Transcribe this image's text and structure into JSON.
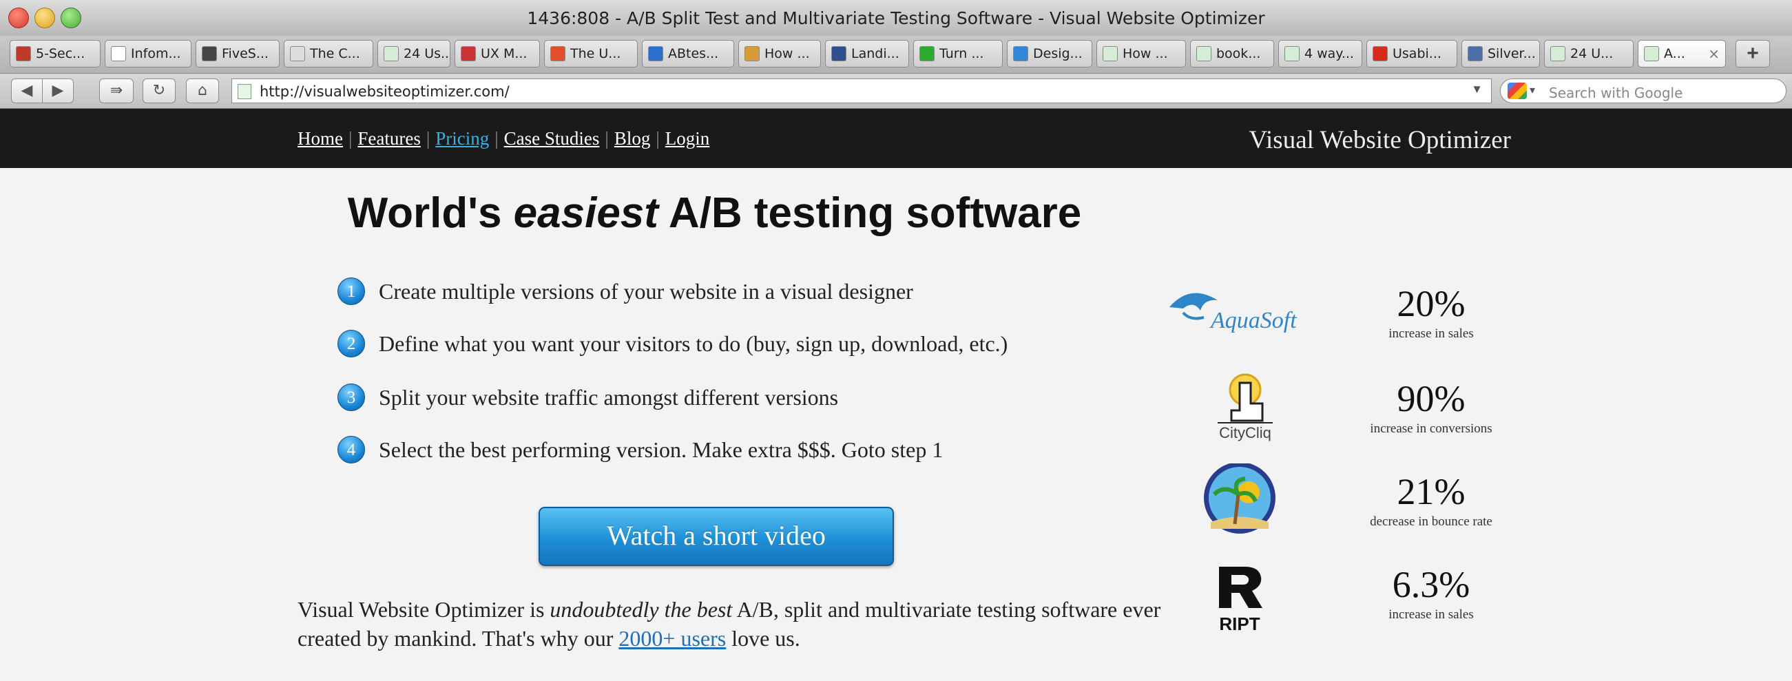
{
  "window": {
    "title": "1436:808 - A/B Split Test and Multivariate Testing Software - Visual Website Optimizer"
  },
  "tabs": [
    {
      "label": "5-Sec...",
      "icon": "five-sec-favicon",
      "color": "#c0392b"
    },
    {
      "label": "Infom...",
      "icon": "blank-favicon",
      "color": "#ffffff"
    },
    {
      "label": "FiveS...",
      "icon": "fivesecond-favicon",
      "color": "#444444"
    },
    {
      "label": "The C...",
      "icon": "page-favicon",
      "color": "#dddddd"
    },
    {
      "label": "24 Us...",
      "icon": "page-favicon",
      "color": "#d5ecd5"
    },
    {
      "label": "UX M...",
      "icon": "uxm-favicon",
      "color": "#cc3333"
    },
    {
      "label": "The U...",
      "icon": "uxbooth-favicon",
      "color": "#e24e2a"
    },
    {
      "label": "ABtes...",
      "icon": "abtests-favicon",
      "color": "#2a6fcf"
    },
    {
      "label": "How ...",
      "icon": "how-favicon",
      "color": "#d99a3a"
    },
    {
      "label": "Landi...",
      "icon": "landing-favicon",
      "color": "#2f4f8f"
    },
    {
      "label": "Turn ...",
      "icon": "turn-favicon",
      "color": "#2eaa2e"
    },
    {
      "label": "Desig...",
      "icon": "design-favicon",
      "color": "#2f87d8"
    },
    {
      "label": "How ...",
      "icon": "page-favicon",
      "color": "#d5ecd5"
    },
    {
      "label": "book...",
      "icon": "page-favicon",
      "color": "#d5ecd5"
    },
    {
      "label": "4 way...",
      "icon": "page-favicon",
      "color": "#d5ecd5"
    },
    {
      "label": "Usabi...",
      "icon": "usability-favicon",
      "color": "#d92a1e"
    },
    {
      "label": "Silver...",
      "icon": "silverback-favicon",
      "color": "#4a6ea8"
    },
    {
      "label": "24 U...",
      "icon": "page-favicon",
      "color": "#d5ecd5"
    },
    {
      "label": "A...",
      "icon": "page-favicon",
      "color": "#d5ecd5",
      "active": true
    }
  ],
  "toolbar": {
    "url": "http://visualwebsiteoptimizer.com/",
    "search_placeholder": "Search with Google",
    "back_icon": "back-arrow-icon",
    "forward_icon": "forward-arrow-icon",
    "reload_icon": "reload-icon",
    "home_icon": "home-icon"
  },
  "site": {
    "nav": [
      "Home",
      "Features",
      "Pricing",
      "Case Studies",
      "Blog",
      "Login"
    ],
    "brand": "Visual Website Optimizer",
    "headline": {
      "pre": "World's ",
      "em": "easiest",
      "post": " A/B testing software"
    },
    "steps": [
      {
        "num": "1",
        "text": "Create multiple versions of your website in a visual designer"
      },
      {
        "num": "2",
        "text": "Define what you want your visitors to do (buy, sign up, download, etc.)"
      },
      {
        "num": "3",
        "text": "Split your website traffic amongst different versions"
      },
      {
        "num": "4",
        "text": "Select the best performing version. Make extra $$$. Goto step 1"
      }
    ],
    "video_button": "Watch a short video",
    "desc": {
      "part1": "Visual Website Optimizer is ",
      "em": "undoubtedly the best",
      "part2": " A/B, split and multivariate testing software ever created by mankind. That's why our ",
      "users_link": "2000+ users",
      "part3": " love us."
    },
    "case_studies": [
      {
        "logo_text": "AquaSoft",
        "logo_icon": "dolphin-icon",
        "value": "20%",
        "label": "increase in sales"
      },
      {
        "logo_text": "CityCliq",
        "logo_icon": "pointer-hand-icon",
        "value": "90%",
        "label": "increase in conversions"
      },
      {
        "logo_text": "",
        "logo_icon": "palm-tree-sun-icon",
        "value": "21%",
        "label": "decrease in bounce rate"
      },
      {
        "logo_text": "RIPT",
        "logo_icon": "ript-r-logo",
        "value": "6.3%",
        "label": "increase in sales"
      }
    ]
  }
}
